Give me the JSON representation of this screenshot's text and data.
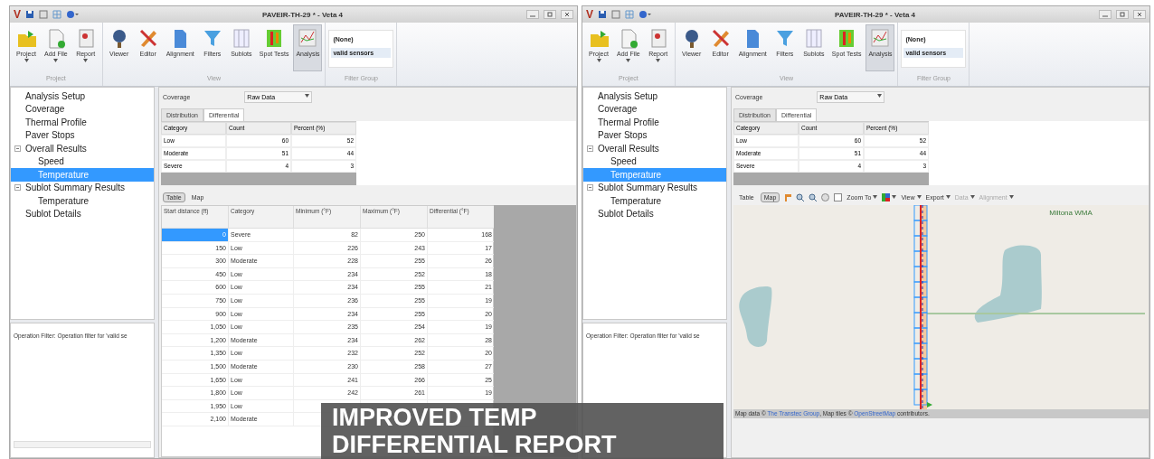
{
  "windows": [
    {
      "logo": "V",
      "title": "PAVEIR-TH-29 * - Veta 4",
      "ribbon": {
        "groups": [
          {
            "label": "Project",
            "buttons": [
              {
                "label": "Project",
                "dropdown": true,
                "selected": false
              },
              {
                "label": "Add File",
                "dropdown": true,
                "selected": false
              },
              {
                "label": "Report",
                "dropdown": true,
                "selected": false
              }
            ]
          },
          {
            "label": "View",
            "buttons": [
              {
                "label": "Viewer",
                "dropdown": false,
                "selected": false
              },
              {
                "label": "Editor",
                "dropdown": false,
                "selected": false
              },
              {
                "label": "Alignment",
                "dropdown": false,
                "selected": false
              },
              {
                "label": "Filters",
                "dropdown": false,
                "selected": false
              },
              {
                "label": "Sublots",
                "dropdown": false,
                "selected": false
              },
              {
                "label": "Spot Tests",
                "dropdown": false,
                "selected": false
              },
              {
                "label": "Analysis",
                "dropdown": false,
                "selected": true
              }
            ]
          }
        ],
        "filter_group": {
          "label": "Filter Group",
          "items": [
            {
              "label": "(None)",
              "selected": false
            },
            {
              "label": "valid sensors",
              "selected": true
            }
          ]
        }
      },
      "tree": [
        {
          "label": "Analysis Setup",
          "selected": false
        },
        {
          "label": "Coverage",
          "selected": false
        },
        {
          "label": "Thermal Profile",
          "selected": false
        },
        {
          "label": "Paver Stops",
          "selected": false
        },
        {
          "label": "Overall Results",
          "selected": false,
          "children": [
            {
              "label": "Speed",
              "selected": false
            },
            {
              "label": "Temperature",
              "selected": true
            }
          ]
        },
        {
          "label": "Sublot Summary Results",
          "selected": false,
          "children": [
            {
              "label": "Temperature",
              "selected": false
            }
          ]
        },
        {
          "label": "Sublot Details",
          "selected": false
        }
      ],
      "filter_note": "Operation Filter: Operation filter for 'valid se",
      "coverage": {
        "label": "Coverage",
        "value": "Raw Data"
      },
      "result_tabs": [
        {
          "label": "Distribution",
          "selected": false
        },
        {
          "label": "Differential",
          "selected": true
        }
      ],
      "summary": {
        "columns": [
          "Category",
          "Count",
          "Percent (%)"
        ],
        "rows": [
          [
            "Low",
            "60",
            "52"
          ],
          [
            "Moderate",
            "51",
            "44"
          ],
          [
            "Severe",
            "4",
            "3"
          ]
        ]
      },
      "view_tabs": [
        {
          "label": "Table",
          "selected": true
        },
        {
          "label": "Map",
          "selected": false
        }
      ],
      "table": {
        "columns": [
          "Start distance (ft)",
          "Category",
          "Minimum (°F)",
          "Maximum (°F)",
          "Differential (°F)"
        ],
        "rows": [
          {
            "cells": [
              "0",
              "Severe",
              "82",
              "250",
              "168"
            ],
            "selected": true
          },
          {
            "cells": [
              "150",
              "Low",
              "226",
              "243",
              "17"
            ],
            "selected": false
          },
          {
            "cells": [
              "300",
              "Moderate",
              "228",
              "255",
              "26"
            ],
            "selected": false
          },
          {
            "cells": [
              "450",
              "Low",
              "234",
              "252",
              "18"
            ],
            "selected": false
          },
          {
            "cells": [
              "600",
              "Low",
              "234",
              "255",
              "21"
            ],
            "selected": false
          },
          {
            "cells": [
              "750",
              "Low",
              "236",
              "255",
              "19"
            ],
            "selected": false
          },
          {
            "cells": [
              "900",
              "Low",
              "234",
              "255",
              "20"
            ],
            "selected": false
          },
          {
            "cells": [
              "1,050",
              "Low",
              "235",
              "254",
              "19"
            ],
            "selected": false
          },
          {
            "cells": [
              "1,200",
              "Moderate",
              "234",
              "262",
              "28"
            ],
            "selected": false
          },
          {
            "cells": [
              "1,350",
              "Low",
              "232",
              "252",
              "20"
            ],
            "selected": false
          },
          {
            "cells": [
              "1,500",
              "Moderate",
              "230",
              "258",
              "27"
            ],
            "selected": false
          },
          {
            "cells": [
              "1,650",
              "Low",
              "241",
              "266",
              "25"
            ],
            "selected": false
          },
          {
            "cells": [
              "1,800",
              "Low",
              "242",
              "261",
              "19"
            ],
            "selected": false
          },
          {
            "cells": [
              "1,950",
              "Low"
            ],
            "selected": false
          },
          {
            "cells": [
              "2,100",
              "Moderate"
            ],
            "selected": false
          }
        ]
      }
    },
    {
      "logo": "V",
      "title": "PAVEIR-TH-29 * - Veta 4",
      "ribbon": {
        "groups": [
          {
            "label": "Project",
            "buttons": [
              {
                "label": "Project",
                "dropdown": true,
                "selected": false
              },
              {
                "label": "Add File",
                "dropdown": true,
                "selected": false
              },
              {
                "label": "Report",
                "dropdown": true,
                "selected": false
              }
            ]
          },
          {
            "label": "View",
            "buttons": [
              {
                "label": "Viewer",
                "dropdown": false,
                "selected": false
              },
              {
                "label": "Editor",
                "dropdown": false,
                "selected": false
              },
              {
                "label": "Alignment",
                "dropdown": false,
                "selected": false
              },
              {
                "label": "Filters",
                "dropdown": false,
                "selected": false
              },
              {
                "label": "Sublots",
                "dropdown": false,
                "selected": false
              },
              {
                "label": "Spot Tests",
                "dropdown": false,
                "selected": false
              },
              {
                "label": "Analysis",
                "dropdown": false,
                "selected": true
              }
            ]
          }
        ],
        "filter_group": {
          "label": "Filter Group",
          "items": [
            {
              "label": "(None)",
              "selected": false
            },
            {
              "label": "valid sensors",
              "selected": true
            }
          ]
        }
      },
      "tree": [
        {
          "label": "Analysis Setup",
          "selected": false
        },
        {
          "label": "Coverage",
          "selected": false
        },
        {
          "label": "Thermal Profile",
          "selected": false
        },
        {
          "label": "Paver Stops",
          "selected": false
        },
        {
          "label": "Overall Results",
          "selected": false,
          "children": [
            {
              "label": "Speed",
              "selected": false
            },
            {
              "label": "Temperature",
              "selected": true
            }
          ]
        },
        {
          "label": "Sublot Summary Results",
          "selected": false,
          "children": [
            {
              "label": "Temperature",
              "selected": false
            }
          ]
        },
        {
          "label": "Sublot Details",
          "selected": false
        }
      ],
      "filter_note": "Operation Filter: Operation filter for 'valid se",
      "coverage": {
        "label": "Coverage",
        "value": "Raw Data"
      },
      "result_tabs": [
        {
          "label": "Distribution",
          "selected": false
        },
        {
          "label": "Differential",
          "selected": true
        }
      ],
      "summary": {
        "columns": [
          "Category",
          "Count",
          "Percent (%)"
        ],
        "rows": [
          [
            "Low",
            "60",
            "52"
          ],
          [
            "Moderate",
            "51",
            "44"
          ],
          [
            "Severe",
            "4",
            "3"
          ]
        ]
      },
      "view_tabs": [
        {
          "label": "Table",
          "selected": false
        },
        {
          "label": "Map",
          "selected": true
        }
      ],
      "map_toolbar": [
        {
          "kind": "icon"
        },
        {
          "kind": "icon"
        },
        {
          "kind": "icon"
        },
        {
          "kind": "icon"
        },
        {
          "kind": "icon"
        },
        {
          "kind": "menu",
          "label": "Zoom To",
          "disabled": false
        },
        {
          "kind": "icon-menu"
        },
        {
          "kind": "menu",
          "label": "View",
          "disabled": false
        },
        {
          "kind": "menu",
          "label": "Export",
          "disabled": false
        },
        {
          "kind": "menu",
          "label": "Data",
          "disabled": true
        },
        {
          "kind": "menu",
          "label": "Alignment",
          "disabled": true
        }
      ],
      "map": {
        "place_label": "Miltona WMA",
        "attribution": [
          {
            "kind": "text",
            "text": "Map data © "
          },
          {
            "kind": "link",
            "text": "The Transtec Group"
          },
          {
            "kind": "text",
            "text": ", Map tiles © "
          },
          {
            "kind": "link",
            "text": "OpenStreetMap"
          },
          {
            "kind": "text",
            "text": " contributors."
          }
        ]
      }
    }
  ],
  "caption": [
    "IMPROVED TEMP",
    "DIFFERENTIAL REPORT"
  ]
}
